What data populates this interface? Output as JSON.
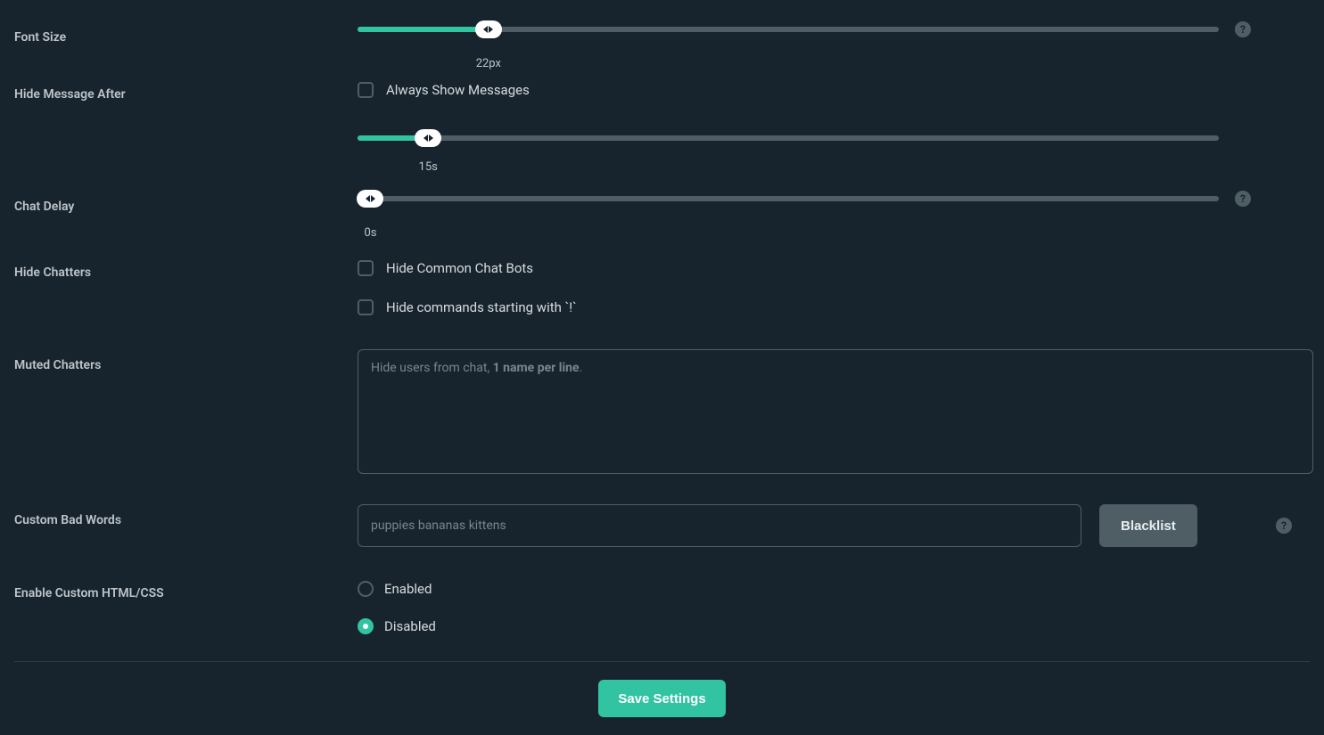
{
  "fontSize": {
    "label": "Font Size",
    "value": "22px",
    "percent": 15.2
  },
  "hideAfter": {
    "label": "Hide Message After",
    "checkboxLabel": "Always Show Messages",
    "value": "15s",
    "percent": 8.2
  },
  "chatDelay": {
    "label": "Chat Delay",
    "value": "0s",
    "percent": 0
  },
  "hideChatters": {
    "label": "Hide Chatters",
    "option1": "Hide Common Chat Bots",
    "option2": "Hide commands starting with `!`"
  },
  "mutedChatters": {
    "label": "Muted Chatters",
    "placeholderPrefix": "Hide users from chat, ",
    "placeholderBold": "1 name per line",
    "placeholderSuffix": "."
  },
  "badWords": {
    "label": "Custom Bad Words",
    "placeholder": "puppies bananas kittens",
    "button": "Blacklist"
  },
  "customHtml": {
    "label": "Enable Custom HTML/CSS",
    "enabled": "Enabled",
    "disabled": "Disabled"
  },
  "save": "Save Settings"
}
